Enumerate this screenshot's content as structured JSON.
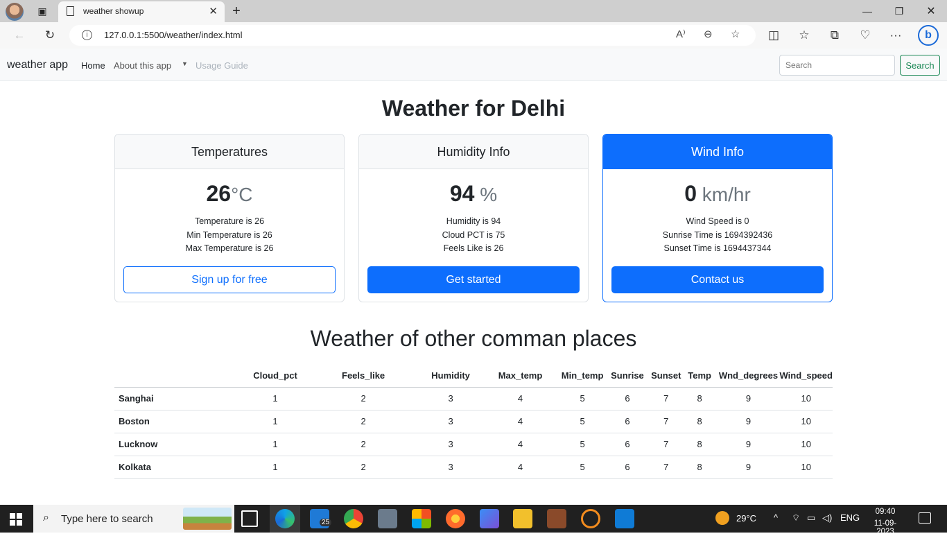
{
  "browser": {
    "tab_title": "weather showup",
    "url": "127.0.0.1:5500/weather/index.html"
  },
  "navbar": {
    "brand": "weather app",
    "links": [
      "Home",
      "About this app",
      "Usage Guide"
    ],
    "search_placeholder": "Search",
    "search_button": "Search"
  },
  "main": {
    "title": "Weather for Delhi",
    "cards": [
      {
        "header": "Temperatures",
        "value": "26",
        "unit": "°C",
        "lines": [
          "Temperature is 26",
          "Min Temperature is 26",
          "Max Temperature is 26"
        ],
        "button": "Sign up for free"
      },
      {
        "header": "Humidity Info",
        "value": "94",
        "unit": " %",
        "lines": [
          "Humidity is 94",
          "Cloud PCT is 75",
          "Feels Like is 26"
        ],
        "button": "Get started"
      },
      {
        "header": "Wind Info",
        "value": "0",
        "unit": " km/hr",
        "lines": [
          "Wind Speed is 0",
          "Sunrise Time is 1694392436",
          "Sunset Time is 1694437344"
        ],
        "button": "Contact us"
      }
    ]
  },
  "table": {
    "heading": "Weather of other comman places",
    "columns": [
      "Cloud_pct",
      "Feels_like",
      "Humidity",
      "Max_temp",
      "Min_temp",
      "Sunrise",
      "Sunset",
      "Temp",
      "Wnd_degrees",
      "Wind_speed"
    ],
    "rows": [
      {
        "place": "Sanghai",
        "values": [
          "1",
          "2",
          "3",
          "4",
          "5",
          "6",
          "7",
          "8",
          "9",
          "10"
        ]
      },
      {
        "place": "Boston",
        "values": [
          "1",
          "2",
          "3",
          "4",
          "5",
          "6",
          "7",
          "8",
          "9",
          "10"
        ]
      },
      {
        "place": "Lucknow",
        "values": [
          "1",
          "2",
          "3",
          "4",
          "5",
          "6",
          "7",
          "8",
          "9",
          "10"
        ]
      },
      {
        "place": "Kolkata",
        "values": [
          "1",
          "2",
          "3",
          "4",
          "5",
          "6",
          "7",
          "8",
          "9",
          "10"
        ]
      }
    ]
  },
  "taskbar": {
    "search_text": "Type here to search",
    "mail_badge": "25",
    "weather": "29°C",
    "language": "ENG",
    "time": "09:40",
    "date": "11-09-2023"
  },
  "colors": {
    "primary": "#0d6efd",
    "success": "#198754",
    "navbar_bg": "#f8f9fa",
    "taskbar_bg": "#202020"
  }
}
